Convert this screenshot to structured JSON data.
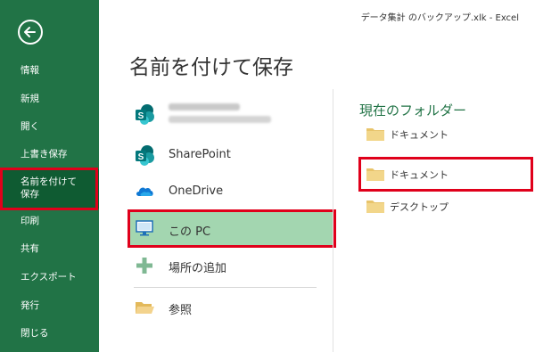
{
  "window": {
    "file_title": "データ集計 のバックアップ.xlk - Excel"
  },
  "sidebar": {
    "back_icon": "back-arrow-icon",
    "items": [
      {
        "label": "情報"
      },
      {
        "label": "新規"
      },
      {
        "label": "開く"
      },
      {
        "label": "上書き保存"
      },
      {
        "label": "名前を付けて\n保存",
        "active": true
      },
      {
        "label": "印刷"
      },
      {
        "label": "共有"
      },
      {
        "label": "エクスポート"
      },
      {
        "label": "発行"
      },
      {
        "label": "閉じる"
      }
    ]
  },
  "main": {
    "title": "名前を付けて保存",
    "locations": [
      {
        "label": "",
        "icon": "sharepoint-icon",
        "blurred": true
      },
      {
        "label": "SharePoint",
        "icon": "sharepoint-icon"
      },
      {
        "label": "OneDrive",
        "icon": "onedrive-icon"
      },
      {
        "label": "この PC",
        "icon": "pc-icon",
        "selected": true
      },
      {
        "label": "場所の追加",
        "icon": "plus-icon"
      },
      {
        "label": "参照",
        "icon": "open-folder-icon"
      }
    ]
  },
  "folders": {
    "heading": "現在のフォルダー",
    "items": [
      {
        "label": "ドキュメント"
      },
      {
        "label": "ドキュメント",
        "highlighted": true
      },
      {
        "label": "デスクトップ"
      }
    ]
  },
  "colors": {
    "accent": "#217346",
    "selected_bg": "#a3d6b0",
    "highlight_border": "#e0001b",
    "folder": "#e8c46a"
  }
}
